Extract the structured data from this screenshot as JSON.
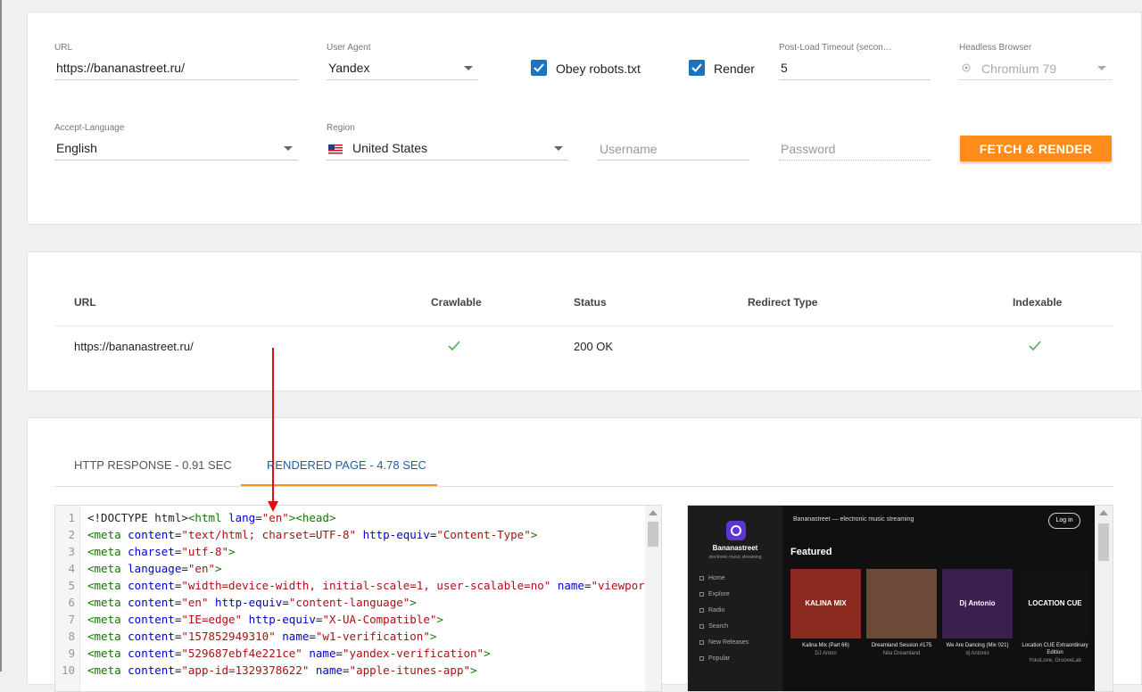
{
  "form": {
    "url": {
      "label": "URL",
      "value": "https://bananastreet.ru/"
    },
    "user_agent": {
      "label": "User Agent",
      "value": "Yandex"
    },
    "obey_robots": {
      "label": "Obey robots.txt",
      "checked": true
    },
    "render": {
      "label": "Render",
      "checked": true
    },
    "timeout": {
      "label": "Post-Load Timeout (secon…",
      "value": "5"
    },
    "headless_browser": {
      "label": "Headless Browser",
      "value": "Chromium 79"
    },
    "accept_language": {
      "label": "Accept-Language",
      "value": "English"
    },
    "region": {
      "label": "Region",
      "value": "United States",
      "flag": "us-flag-icon"
    },
    "username": {
      "placeholder": "Username"
    },
    "password": {
      "placeholder": "Password"
    },
    "fetch_button": "FETCH & RENDER"
  },
  "results": {
    "columns": [
      "URL",
      "Crawlable",
      "Status",
      "Redirect Type",
      "Indexable"
    ],
    "rows": [
      {
        "url": "https://bananastreet.ru/",
        "crawlable": "check-icon",
        "status": "200 OK",
        "redirect_type": "",
        "indexable": "check-icon"
      }
    ]
  },
  "output": {
    "tabs": [
      {
        "label": "HTTP RESPONSE - 0.91 SEC",
        "active": false
      },
      {
        "label": "RENDERED PAGE - 4.78 SEC",
        "active": true
      }
    ],
    "code_lines": [
      {
        "n": "1",
        "tokens": [
          [
            "t-plain",
            "<!DOCTYPE html>"
          ],
          [
            "t-tag",
            "<html "
          ],
          [
            "t-attr",
            "lang"
          ],
          [
            "t-plain",
            "="
          ],
          [
            "t-str",
            "\"en\""
          ],
          [
            "t-tag",
            ">"
          ],
          [
            "t-tag",
            "<head>"
          ]
        ]
      },
      {
        "n": "2",
        "tokens": [
          [
            "t-tag",
            "<meta "
          ],
          [
            "t-attr",
            "content"
          ],
          [
            "t-plain",
            "="
          ],
          [
            "t-str",
            "\"text/html; charset=UTF-8\""
          ],
          [
            "t-plain",
            " "
          ],
          [
            "t-attr",
            "http-equiv"
          ],
          [
            "t-plain",
            "="
          ],
          [
            "t-str",
            "\"Content-Type\""
          ],
          [
            "t-tag",
            ">"
          ]
        ]
      },
      {
        "n": "3",
        "tokens": [
          [
            "t-tag",
            "<meta "
          ],
          [
            "t-attr",
            "charset"
          ],
          [
            "t-plain",
            "="
          ],
          [
            "t-str",
            "\"utf-8\""
          ],
          [
            "t-tag",
            ">"
          ]
        ]
      },
      {
        "n": "4",
        "tokens": [
          [
            "t-tag",
            "<meta "
          ],
          [
            "t-attr",
            "language"
          ],
          [
            "t-plain",
            "="
          ],
          [
            "t-str",
            "\"en\""
          ],
          [
            "t-tag",
            ">"
          ]
        ]
      },
      {
        "n": "5",
        "tokens": [
          [
            "t-tag",
            "<meta "
          ],
          [
            "t-attr",
            "content"
          ],
          [
            "t-plain",
            "="
          ],
          [
            "t-str",
            "\"width=device-width, initial-scale=1, user-scalable=no\""
          ],
          [
            "t-plain",
            " "
          ],
          [
            "t-attr",
            "name"
          ],
          [
            "t-plain",
            "="
          ],
          [
            "t-str",
            "\"viewport\""
          ]
        ]
      },
      {
        "n": "6",
        "tokens": [
          [
            "t-tag",
            "<meta "
          ],
          [
            "t-attr",
            "content"
          ],
          [
            "t-plain",
            "="
          ],
          [
            "t-str",
            "\"en\""
          ],
          [
            "t-plain",
            " "
          ],
          [
            "t-attr",
            "http-equiv"
          ],
          [
            "t-plain",
            "="
          ],
          [
            "t-str",
            "\"content-language\""
          ],
          [
            "t-tag",
            ">"
          ]
        ]
      },
      {
        "n": "7",
        "tokens": [
          [
            "t-tag",
            "<meta "
          ],
          [
            "t-attr",
            "content"
          ],
          [
            "t-plain",
            "="
          ],
          [
            "t-str",
            "\"IE=edge\""
          ],
          [
            "t-plain",
            " "
          ],
          [
            "t-attr",
            "http-equiv"
          ],
          [
            "t-plain",
            "="
          ],
          [
            "t-str",
            "\"X-UA-Compatible\""
          ],
          [
            "t-tag",
            ">"
          ]
        ]
      },
      {
        "n": "8",
        "tokens": [
          [
            "t-tag",
            "<meta "
          ],
          [
            "t-attr",
            "content"
          ],
          [
            "t-plain",
            "="
          ],
          [
            "t-str",
            "\"157852949310\""
          ],
          [
            "t-plain",
            " "
          ],
          [
            "t-attr",
            "name"
          ],
          [
            "t-plain",
            "="
          ],
          [
            "t-str",
            "\"w1-verification\""
          ],
          [
            "t-tag",
            ">"
          ]
        ]
      },
      {
        "n": "9",
        "tokens": [
          [
            "t-tag",
            "<meta "
          ],
          [
            "t-attr",
            "content"
          ],
          [
            "t-plain",
            "="
          ],
          [
            "t-str",
            "\"529687ebf4e221ce\""
          ],
          [
            "t-plain",
            " "
          ],
          [
            "t-attr",
            "name"
          ],
          [
            "t-plain",
            "="
          ],
          [
            "t-str",
            "\"yandex-verification\""
          ],
          [
            "t-tag",
            ">"
          ]
        ]
      },
      {
        "n": "10",
        "tokens": [
          [
            "t-tag",
            "<meta "
          ],
          [
            "t-attr",
            "content"
          ],
          [
            "t-plain",
            "="
          ],
          [
            "t-str",
            "\"app-id=1329378622\""
          ],
          [
            "t-plain",
            " "
          ],
          [
            "t-attr",
            "name"
          ],
          [
            "t-plain",
            "="
          ],
          [
            "t-str",
            "\"apple-itunes-app\""
          ],
          [
            "t-tag",
            ">"
          ]
        ]
      }
    ],
    "preview": {
      "site_title": "Bananastreet — electronic music streaming",
      "login": "Log in",
      "brand": "Bananastreet",
      "tagline": "electronic music streaming",
      "nav": [
        "Home",
        "Explore",
        "Radio",
        "Search",
        "New Releases",
        "Popular"
      ],
      "featured": "Featured",
      "cards": [
        {
          "title": "Kalina Mix (Part 66)",
          "sub": "DJ Anton",
          "color": "#8a2a1e"
        },
        {
          "title": "Dreamland Session #175",
          "sub": "Nita Dreamland",
          "color": "#6b4a3a"
        },
        {
          "title": "We Are Dancing (Mix 021)",
          "sub": "dj Antonio",
          "color": "#3b1f4f"
        },
        {
          "title": "Location CUE Extraordinary Edition",
          "sub": "YokoLove, GrooveLab",
          "color": "#111111"
        }
      ],
      "card_art": [
        "KALINA MIX",
        "",
        "Dj Antonio",
        "LOCATION CUE"
      ]
    }
  },
  "colors": {
    "accent": "#ff8c1a",
    "primary": "#1e73be",
    "check": "#4caf50",
    "annotation": "#e01010"
  }
}
